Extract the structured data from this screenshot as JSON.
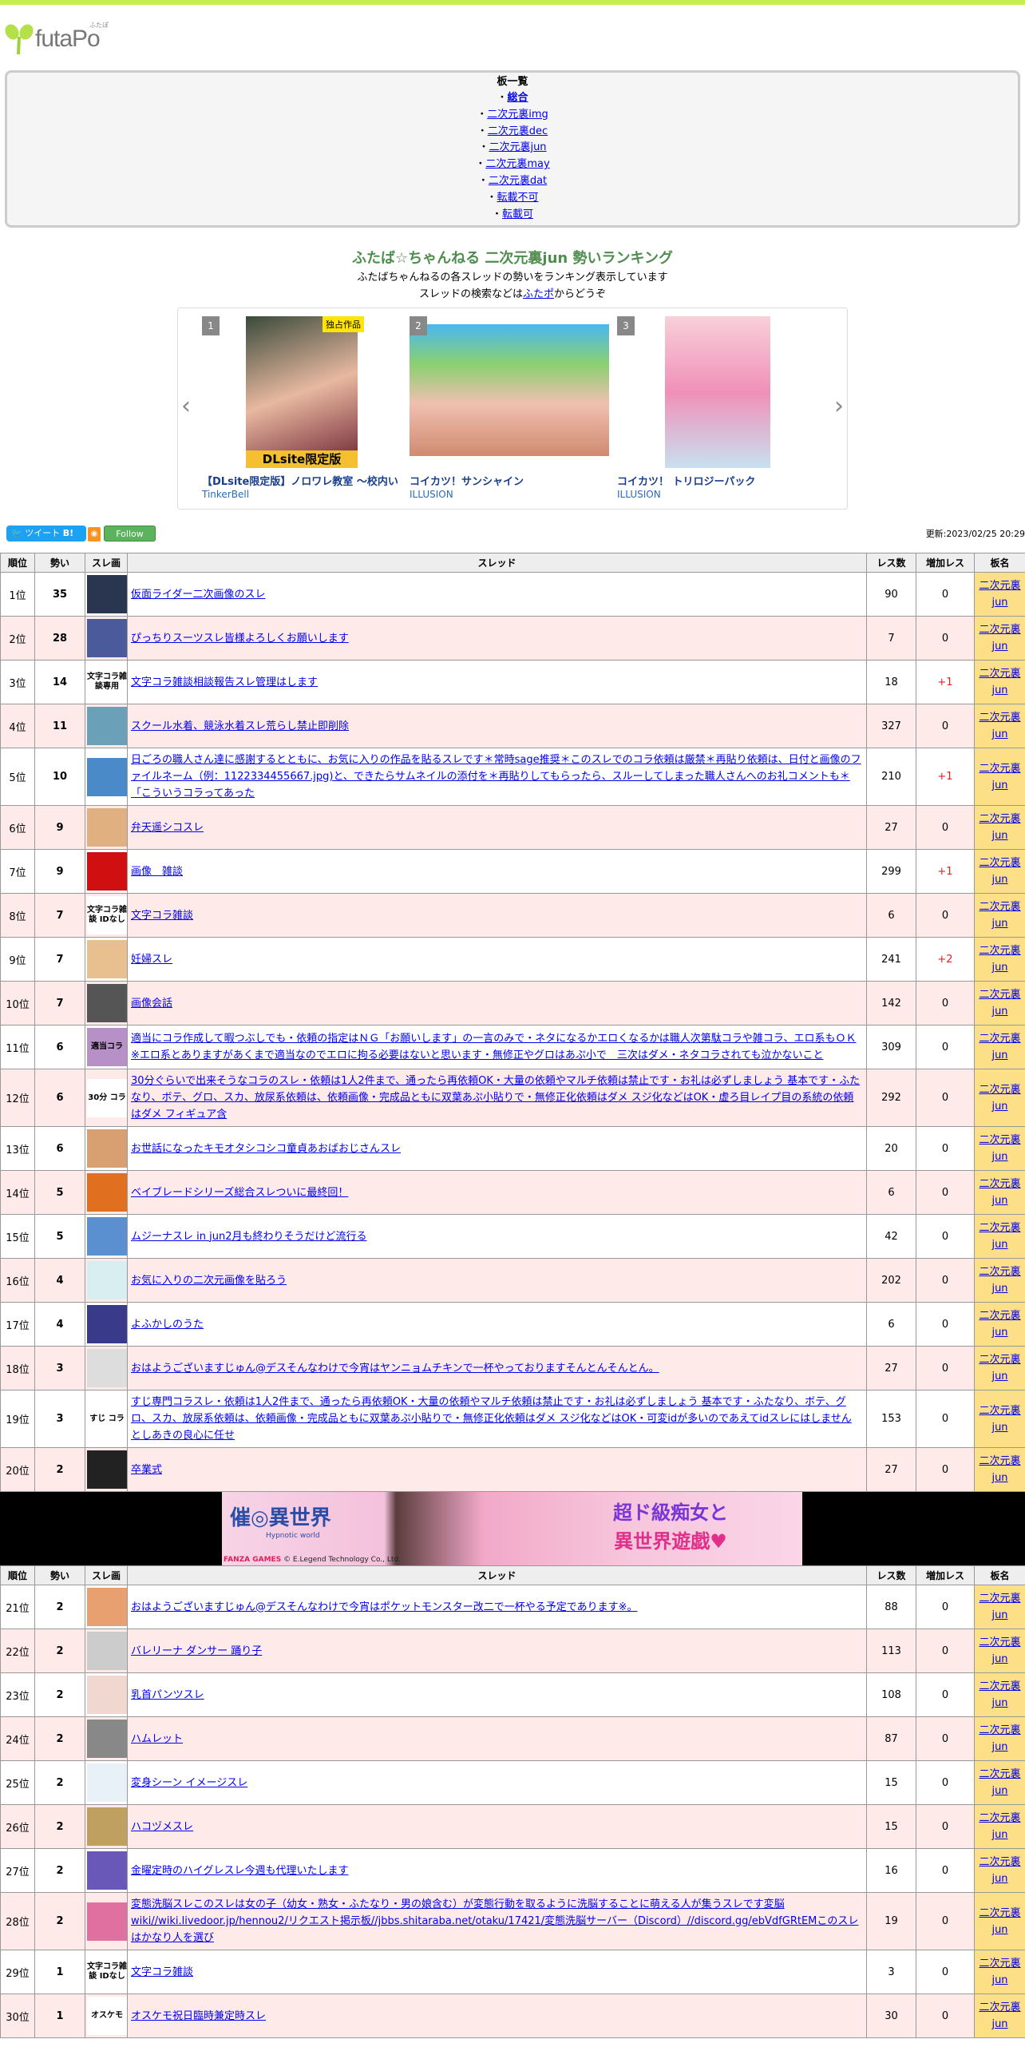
{
  "logo": {
    "name": "futaPo",
    "kana": "ふたぽ"
  },
  "boards": {
    "heading": "板一覧",
    "items": [
      "総合",
      "二次元裏img",
      "二次元裏dec",
      "二次元裏jun",
      "二次元裏may",
      "二次元裏dat",
      "転載不可",
      "転載可"
    ]
  },
  "page": {
    "title": "ふたば☆ちゃんねる 二次元裏jun 勢いランキング",
    "sub1": "ふたばちゃんねるの各スレッドの勢いをランキング表示しています",
    "sub2_pre": "スレッドの検索などは",
    "sub2_link": "ふたポ",
    "sub2_post": "からどうぞ"
  },
  "carousel": {
    "items": [
      {
        "num": "1",
        "title": "【DLsite限定版】ノロワレ教室 ～校内い",
        "maker": "TinkerBell",
        "badge": "独占作品",
        "banner": "DLsite限定版"
      },
      {
        "num": "2",
        "title": "コイカツ！サンシャイン",
        "maker": "ILLUSION"
      },
      {
        "num": "3",
        "title": "コイカツ！ トリロジーパック",
        "maker": "ILLUSION"
      }
    ]
  },
  "share": {
    "tweet": "ツイート",
    "hatena": "B!",
    "follow": "Follow",
    "updated": "更新:2023/02/25 20:29"
  },
  "table": {
    "headers": [
      "順位",
      "勢い",
      "スレ画",
      "スレッド",
      "レス数",
      "増加レス",
      "板名"
    ],
    "board_line1": "二次元裏",
    "board_line2": "jun"
  },
  "ad": {
    "logo": "催◎異世界",
    "logo_sub": "Hypnotic world",
    "copy1": "超ド級痴女と",
    "copy2": "異世界遊戯♥",
    "brand": "FANZA GAMES",
    "copyright": "© E.Legend Technology Co., Ltd."
  },
  "rows": [
    {
      "rank": "1位",
      "ikioi": "35",
      "title": "仮面ライダー二次画像のスレ",
      "res": "90",
      "inc": "0",
      "thumb": "#2a3550"
    },
    {
      "rank": "2位",
      "ikioi": "28",
      "title": "ぴっちりスーツスレ皆様よろしくお願いします",
      "res": "7",
      "inc": "0",
      "thumb": "#4a5a9a"
    },
    {
      "rank": "3位",
      "ikioi": "14",
      "title": "文字コラ雑談相談報告スレ管理はします",
      "res": "18",
      "inc": "+1",
      "thumb": "#ffffff",
      "thumb_text": "文字コラ雑談専用"
    },
    {
      "rank": "4位",
      "ikioi": "11",
      "title": "スクール水着、競泳水着スレ荒らし禁止即削除",
      "res": "327",
      "inc": "0",
      "thumb": "#6aa0b8"
    },
    {
      "rank": "5位",
      "ikioi": "10",
      "title": "日ごろの職人さん達に感謝するとともに、お気に入りの作品を貼るスレです＊常時sage推奨＊このスレでのコラ依頼は厳禁＊再貼り依頼は、日付と画像のファイルネーム（例：1122334455667.jpg)と、できたらサムネイルの添付を＊再貼りしてもらったら、スルーしてしまった職人さんへのお礼コメントも＊「こういうコラってあった",
      "res": "210",
      "inc": "+1",
      "thumb": "#4a8ac8"
    },
    {
      "rank": "6位",
      "ikioi": "9",
      "title": "弁天遥シコスレ",
      "res": "27",
      "inc": "0",
      "thumb": "#e0b080"
    },
    {
      "rank": "7位",
      "ikioi": "9",
      "title": "画像　雑談",
      "res": "299",
      "inc": "+1",
      "thumb": "#d01010"
    },
    {
      "rank": "8位",
      "ikioi": "7",
      "title": "文字コラ雑談",
      "res": "6",
      "inc": "0",
      "thumb": "#ffffff",
      "thumb_text": "文字コラ雑談 IDなし"
    },
    {
      "rank": "9位",
      "ikioi": "7",
      "title": "妊婦スレ",
      "res": "241",
      "inc": "+2",
      "thumb": "#e8c090"
    },
    {
      "rank": "10位",
      "ikioi": "7",
      "title": "画像会話",
      "res": "142",
      "inc": "0",
      "thumb": "#555555"
    },
    {
      "rank": "11位",
      "ikioi": "6",
      "title": "適当にコラ作成して暇つぶしでも・依頼の指定はＮＧ「お願いします」の一言のみで・ネタになるかエロくなるかは職人次第駄コラや雑コラ、エロ系もＯＫ※エロ系とありますがあくまで適当なのでエロに拘る必要はないと思います・無修正やグロはあぷ小で　三次はダメ・ネタコラされても泣かないこと",
      "res": "309",
      "inc": "0",
      "thumb": "#b890c8",
      "thumb_text": "適当コラ"
    },
    {
      "rank": "12位",
      "ikioi": "6",
      "title": "30分ぐらいで出来そうなコラのスレ・依頼は1人2件まで、通ったら再依頼OK・大量の依頼やマルチ依頼は禁止です・お礼は必ずしましょう 基本です・ふたなり、ボテ、グロ、スカ、放尿系依頼は、依頼画像・完成品ともに双葉あぷ小貼りで・無修正化依頼はダメ スジ化などはOK・虚ろ目レイプ目の系統の依頼はダメ フィギュア含",
      "res": "292",
      "inc": "0",
      "thumb": "#ffffff",
      "thumb_text": "30分 コラ"
    },
    {
      "rank": "13位",
      "ikioi": "6",
      "title": "お世話になったキモオタシコシコ童貞あおばおじさんスレ",
      "res": "20",
      "inc": "0",
      "thumb": "#d8a070"
    },
    {
      "rank": "14位",
      "ikioi": "5",
      "title": "ベイブレードシリーズ総合スレついに最終回！",
      "res": "6",
      "inc": "0",
      "thumb": "#e07020"
    },
    {
      "rank": "15位",
      "ikioi": "5",
      "title": "ムジーナスレ in jun2月も終わりそうだけど流行る",
      "res": "42",
      "inc": "0",
      "thumb": "#5a90d0"
    },
    {
      "rank": "16位",
      "ikioi": "4",
      "title": "お気に入りの二次元画像を貼ろう",
      "res": "202",
      "inc": "0",
      "thumb": "#d8eef0"
    },
    {
      "rank": "17位",
      "ikioi": "4",
      "title": "よふかしのうた",
      "res": "6",
      "inc": "0",
      "thumb": "#3a3a8a"
    },
    {
      "rank": "18位",
      "ikioi": "3",
      "title": "おはようございますじゅん@デスそんなわけで今宵はヤンニョムチキンで一杯やっておりますそんとんそんとん。",
      "res": "27",
      "inc": "0",
      "thumb": "#dddddd"
    },
    {
      "rank": "19位",
      "ikioi": "3",
      "title": "すじ専門コラスレ・依頼は1人2件まで、通ったら再依頼OK・大量の依頼やマルチ依頼は禁止です・お礼は必ずしましょう 基本です・ふたなり、ボテ、グロ、スカ、放尿系依頼は、依頼画像・完成品ともに双葉あぷ小貼りで・無修正化依頼はダメ スジ化などはOK・可変idが多いのであえてidスレにはしません としあきの良心に任せ",
      "res": "153",
      "inc": "0",
      "thumb": "#ffffff",
      "thumb_text": "すじ コラ"
    },
    {
      "rank": "20位",
      "ikioi": "2",
      "title": "卒業式",
      "res": "27",
      "inc": "0",
      "thumb": "#222222"
    },
    {
      "rank": "21位",
      "ikioi": "2",
      "title": "おはようございますじゅん@デスそんなわけで今宵はポケットモンスター改二で一杯やる予定であります※。",
      "res": "88",
      "inc": "0",
      "thumb": "#e8a070"
    },
    {
      "rank": "22位",
      "ikioi": "2",
      "title": "バレリーナ ダンサー 踊り子",
      "res": "113",
      "inc": "0",
      "thumb": "#cccccc"
    },
    {
      "rank": "23位",
      "ikioi": "2",
      "title": "乳首パンツスレ",
      "res": "108",
      "inc": "0",
      "thumb": "#f0d8d0"
    },
    {
      "rank": "24位",
      "ikioi": "2",
      "title": "ハムレット",
      "res": "87",
      "inc": "0",
      "thumb": "#888888"
    },
    {
      "rank": "25位",
      "ikioi": "2",
      "title": "変身シーン イメージスレ",
      "res": "15",
      "inc": "0",
      "thumb": "#e8f0f8"
    },
    {
      "rank": "26位",
      "ikioi": "2",
      "title": "ハコヅメスレ",
      "res": "15",
      "inc": "0",
      "thumb": "#c0a060"
    },
    {
      "rank": "27位",
      "ikioi": "2",
      "title": "金曜定時のハイグレスレ今週も代理いたします",
      "res": "16",
      "inc": "0",
      "thumb": "#6a58b8"
    },
    {
      "rank": "28位",
      "ikioi": "2",
      "title": "変態洗脳スレこのスレは女の子（幼女・熟女・ふたなり・男の娘含む）が変態行動を取るように洗脳することに萌える人が集うスレです変脳wiki//wiki.livedoor.jp/hennou2/リクエスト掲示板//jbbs.shitaraba.net/otaku/17421/変態洗脳サーバー（Discord）//discord.gg/ebVdfGRtEMこのスレはかなり人を選び",
      "res": "19",
      "inc": "0",
      "thumb": "#e070a0"
    },
    {
      "rank": "29位",
      "ikioi": "1",
      "title": "文字コラ雑談",
      "res": "3",
      "inc": "0",
      "thumb": "#ffffff",
      "thumb_text": "文字コラ雑談 IDなし"
    },
    {
      "rank": "30位",
      "ikioi": "1",
      "title": "オスケモ祝日臨時兼定時スレ",
      "res": "30",
      "inc": "0",
      "thumb": "#ffffff",
      "thumb_text": "オスケモ"
    }
  ]
}
